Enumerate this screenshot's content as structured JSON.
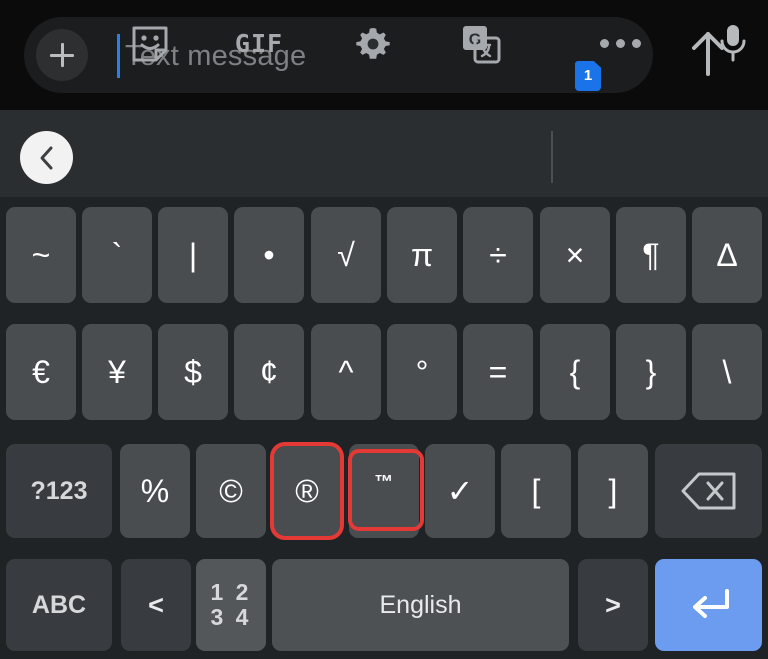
{
  "compose": {
    "add_icon": "plus-icon",
    "placeholder": "Text message",
    "value": "",
    "sim_badge": "1",
    "send_icon": "send-arrow-up-icon",
    "caret_color": "#2a7fe8",
    "badge_color": "#1a73e8"
  },
  "toolbar": {
    "items": [
      {
        "name": "back-button",
        "icon": "chevron-left-icon",
        "label": ""
      },
      {
        "name": "sticker-button",
        "icon": "sticker-icon",
        "label": ""
      },
      {
        "name": "gif-button",
        "icon": "gif-icon",
        "label": "GIF"
      },
      {
        "name": "settings-button",
        "icon": "gear-icon",
        "label": ""
      },
      {
        "name": "translate-button",
        "icon": "google-translate-icon",
        "label": ""
      },
      {
        "name": "more-options-button",
        "icon": "three-dots-icon",
        "label": ""
      },
      {
        "name": "voice-input-button",
        "icon": "microphone-icon",
        "label": ""
      }
    ]
  },
  "keyboard": {
    "layout_name": "symbols",
    "rows": [
      {
        "name": "symbol-row-1",
        "keys": [
          {
            "label": "~",
            "name": "key-tilde"
          },
          {
            "label": "`",
            "name": "key-grave"
          },
          {
            "label": "|",
            "name": "key-pipe"
          },
          {
            "label": "•",
            "name": "key-bullet"
          },
          {
            "label": "√",
            "name": "key-square-root"
          },
          {
            "label": "π",
            "name": "key-pi"
          },
          {
            "label": "÷",
            "name": "key-divide"
          },
          {
            "label": "×",
            "name": "key-multiply"
          },
          {
            "label": "¶",
            "name": "key-pilcrow"
          },
          {
            "label": "Δ",
            "name": "key-delta"
          }
        ]
      },
      {
        "name": "symbol-row-2",
        "keys": [
          {
            "label": "€",
            "name": "key-euro"
          },
          {
            "label": "¥",
            "name": "key-yen"
          },
          {
            "label": "$",
            "name": "key-dollar"
          },
          {
            "label": "¢",
            "name": "key-cent"
          },
          {
            "label": "^",
            "name": "key-caret-symbol"
          },
          {
            "label": "°",
            "name": "key-degree"
          },
          {
            "label": "=",
            "name": "key-equals"
          },
          {
            "label": "{",
            "name": "key-left-brace"
          },
          {
            "label": "}",
            "name": "key-right-brace"
          },
          {
            "label": "\\",
            "name": "key-backslash"
          }
        ]
      },
      {
        "name": "symbol-row-3",
        "keys": [
          {
            "label": "?123",
            "name": "key-numbers-symbols"
          },
          {
            "label": "%",
            "name": "key-percent"
          },
          {
            "label": "©",
            "name": "key-copyright"
          },
          {
            "label": "®",
            "name": "key-registered",
            "highlighted": true
          },
          {
            "label": "™",
            "name": "key-trademark",
            "highlighted": true
          },
          {
            "label": "✓",
            "name": "key-check-mark"
          },
          {
            "label": "[",
            "name": "key-left-bracket"
          },
          {
            "label": "]",
            "name": "key-right-bracket"
          },
          {
            "label": "",
            "name": "key-backspace",
            "icon": "backspace-icon"
          }
        ]
      },
      {
        "name": "bottom-row",
        "keys": [
          {
            "label": "ABC",
            "name": "key-abc"
          },
          {
            "label": "<",
            "name": "key-less-than"
          },
          {
            "label": "1234",
            "name": "key-numeric-pad"
          },
          {
            "label": "English",
            "name": "key-spacebar"
          },
          {
            "label": ">",
            "name": "key-greater-than"
          },
          {
            "label": "",
            "name": "key-enter",
            "icon": "enter-icon"
          }
        ]
      }
    ],
    "highlight_color": "#e53935",
    "enter_key_color": "#6b9cf0"
  }
}
